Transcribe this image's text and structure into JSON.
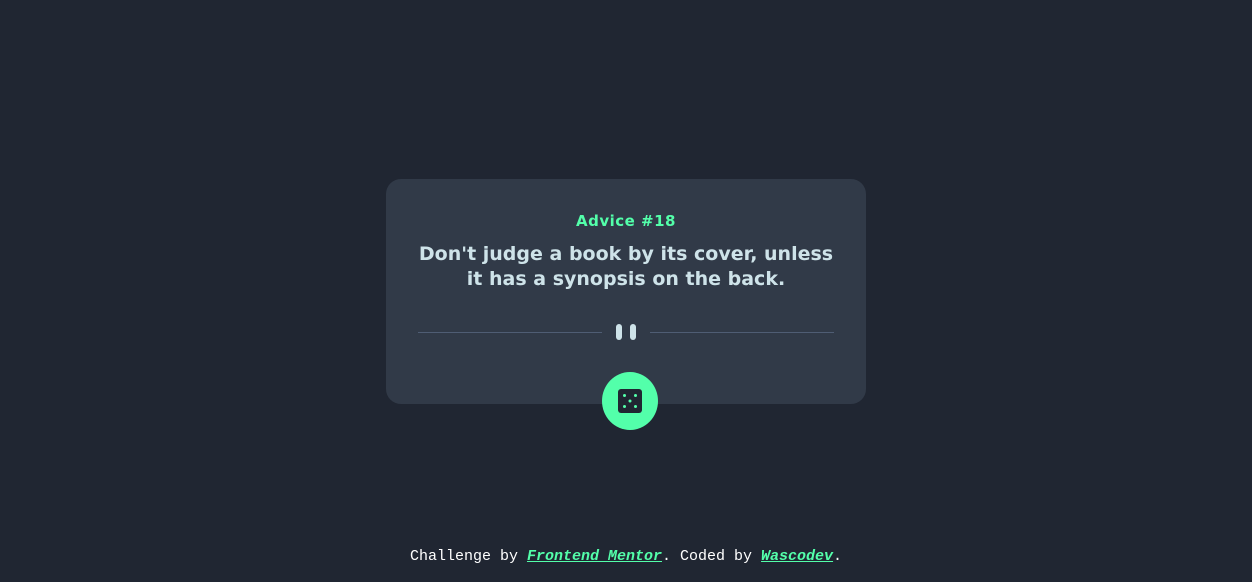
{
  "card": {
    "advice_label": "Advice #18",
    "advice_text": "Don't judge a book by its cover, unless it has a synopsis on the back."
  },
  "icons": {
    "divider": "pause-icon",
    "button": "dice-icon"
  },
  "colors": {
    "background": "#202632",
    "card": "#313a48",
    "accent": "#53ffaa",
    "text": "#cee3e9"
  },
  "footer": {
    "prefix": "Challenge by ",
    "link1": "Frontend Mentor",
    "middle": ". Coded by ",
    "link2": "Wascodev",
    "suffix": "."
  }
}
